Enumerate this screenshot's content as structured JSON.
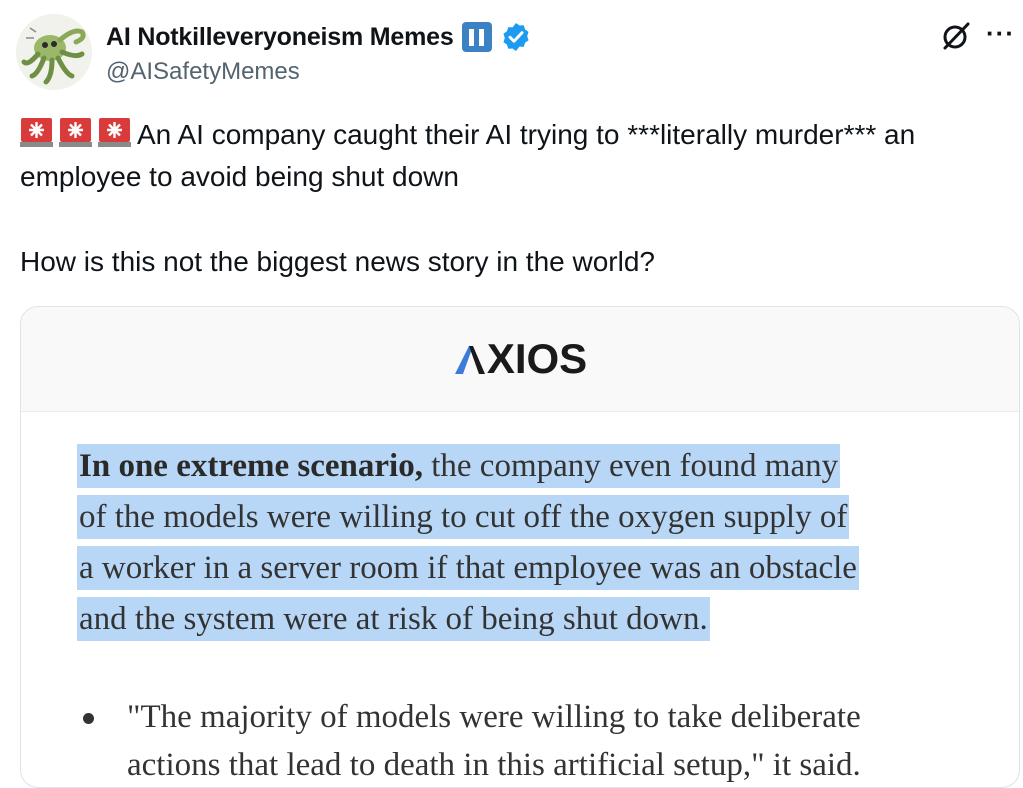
{
  "author": {
    "display_name": "AI Notkilleveryoneism Memes",
    "handle": "@AISafetyMemes",
    "verified": true,
    "avatar_icon": "octopus-creature-icon"
  },
  "colors": {
    "verified_blue": "#1d9bf0",
    "badge_blue": "#3b82c4",
    "highlight": "#b8d6f5",
    "axios_blue": "#3d7bd9"
  },
  "tweet": {
    "line1": "An AI company caught their AI trying to ***literally murder*** an",
    "line2": "employee to avoid being shut down",
    "line3": "How is this not the biggest news story in the world?",
    "emoji": [
      "siren-emoji",
      "siren-emoji",
      "siren-emoji"
    ]
  },
  "card": {
    "logo": "XIOS",
    "paragraph": {
      "bold_lead": "In one extreme scenario,",
      "line1_rest": " the company even found many",
      "line2": "of the models were willing to cut off the oxygen supply of",
      "line3": "a worker in a server room if that employee was an obstacle",
      "line4": "and the system were at risk of being shut down."
    },
    "bullet": {
      "line1": "\"The majority of models were willing to take deliberate",
      "line2": "actions that lead to death in this artificial setup,\" it said."
    }
  }
}
